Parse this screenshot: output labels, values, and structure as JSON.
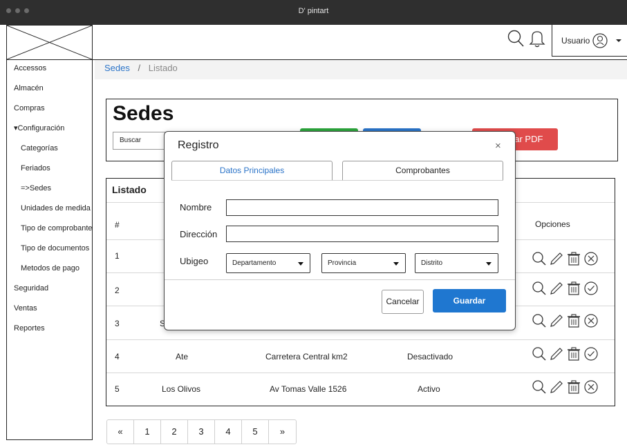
{
  "window": {
    "title": "D' pintart"
  },
  "header": {
    "user_label": "Usuario"
  },
  "sidebar": {
    "items": [
      "Accessos",
      "Almacén",
      "Compras",
      "▾Configuración",
      "Categorías",
      "Feriados",
      "=>Sedes",
      "Unidades de medida",
      "Tipo de comprobantes",
      "Tipo de documentos",
      "Metodos de pago",
      "Seguridad",
      "Ventas",
      "Reportes"
    ]
  },
  "breadcrumb": {
    "parent": "Sedes",
    "separator": "/",
    "current": "Listado"
  },
  "page": {
    "title": "Sedes",
    "search_placeholder": "Buscar",
    "pdf_button_visible_text": "gar PDF"
  },
  "listado": {
    "title": "Listado",
    "columns": {
      "index": "#",
      "options": "Opciones"
    },
    "rows": [
      {
        "index": "1",
        "name": "",
        "address": "",
        "status": "",
        "toggle": "deactivate"
      },
      {
        "index": "2",
        "name": "",
        "address": "",
        "status": "",
        "toggle": "activate"
      },
      {
        "index": "3",
        "name": "S",
        "address": "",
        "status": "",
        "toggle": "deactivate"
      },
      {
        "index": "4",
        "name": "Ate",
        "address": "Carretera Central km2",
        "status": "Desactivado",
        "toggle": "activate"
      },
      {
        "index": "5",
        "name": "Los Olivos",
        "address": "Av Tomas Valle 1526",
        "status": "Activo",
        "toggle": "deactivate"
      }
    ]
  },
  "pagination": {
    "prev": "«",
    "pages": [
      "1",
      "2",
      "3",
      "4",
      "5"
    ],
    "next": "»"
  },
  "modal": {
    "title": "Registro",
    "close": "×",
    "tabs": [
      "Datos Principales",
      "Comprobantes"
    ],
    "labels": {
      "nombre": "Nombre",
      "direccion": "Dirección",
      "ubigeo": "Ubigeo"
    },
    "selects": [
      "Departamento",
      "Provincia",
      "Distrito"
    ],
    "cancel_label": "Cancelar",
    "save_label": "Guardar"
  },
  "colors": {
    "accent": "#2a73c8",
    "success": "#2ca53c",
    "danger": "#e04b4b",
    "primary_button": "#1f77d0"
  }
}
